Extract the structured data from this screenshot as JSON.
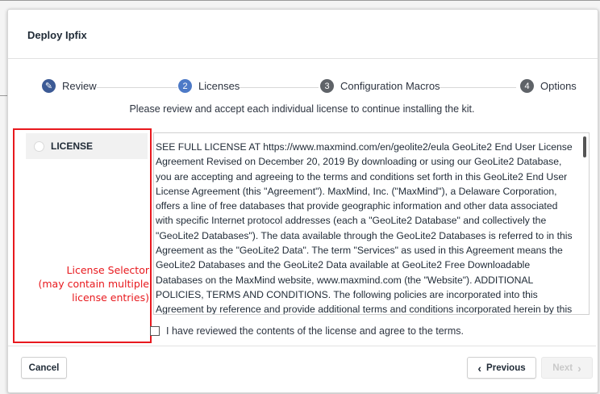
{
  "dialog": {
    "title": "Deploy Ipfix"
  },
  "steps": [
    {
      "number": "✎",
      "label": "Review"
    },
    {
      "number": "2",
      "label": "Licenses"
    },
    {
      "number": "3",
      "label": "Configuration Macros"
    },
    {
      "number": "4",
      "label": "Options"
    }
  ],
  "instruction": "Please review and accept each individual license to continue installing the kit.",
  "license_selector": {
    "items": [
      {
        "label": "LICENSE"
      }
    ]
  },
  "annotation": {
    "line1": "License Selector",
    "line2": "(may contain multiple",
    "line3": "license entries)",
    "color": "#e8191e"
  },
  "license": {
    "text": "SEE FULL LICENSE AT https://www.maxmind.com/en/geolite2/eula GeoLite2 End User License Agreement Revised on December 20, 2019 By downloading or using our GeoLite2 Database, you are accepting and agreeing to the terms and conditions set forth in this GeoLite2 End User License Agreement (this \"Agreement\"). MaxMind, Inc. (\"MaxMind\"), a Delaware Corporation, offers a line of free databases that provide geographic information and other data associated with specific Internet protocol addresses (each a \"GeoLite2 Database\" and collectively the \"GeoLite2 Databases\"). The data available through the GeoLite2 Databases is referred to in this Agreement as the \"GeoLite2 Data\". The term \"Services\" as used in this Agreement means the GeoLite2 Databases and the GeoLite2 Data available at GeoLite2 Free Downloadable Databases on the MaxMind website, www.maxmind.com (the \"Website\"). ADDITIONAL POLICIES, TERMS AND CONDITIONS. The following policies are incorporated into this Agreement by reference and provide additional terms and conditions incorporated herein by this reference and/or"
  },
  "agree": {
    "label": "I have reviewed the contents of the license and agree to the terms."
  },
  "footer": {
    "cancel": "Cancel",
    "previous": "Previous",
    "previous_icon": "‹",
    "next": "Next",
    "next_icon": "›"
  },
  "colors": {
    "active_step": "#4d7ac7",
    "done_step": "#3c5a95"
  }
}
